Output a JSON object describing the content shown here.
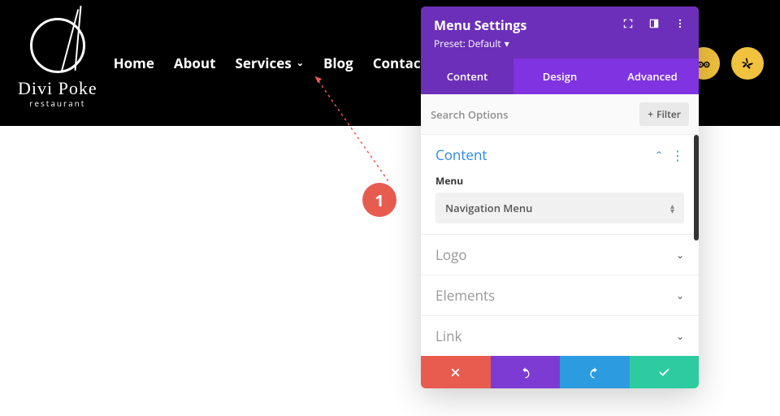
{
  "site": {
    "logo_name": "Divi Poke",
    "logo_sub": "restaurant",
    "nav": [
      "Home",
      "About",
      "Services",
      "Blog",
      "Contact"
    ]
  },
  "panel": {
    "title": "Menu Settings",
    "preset": "Preset: Default",
    "tabs": [
      "Content",
      "Design",
      "Advanced"
    ],
    "search_label": "Search Options",
    "filter_label": "Filter",
    "sections": {
      "content": "Content",
      "logo": "Logo",
      "elements": "Elements",
      "link": "Link"
    },
    "field": {
      "menu_label": "Menu",
      "menu_value": "Navigation Menu"
    }
  },
  "callout": "1"
}
